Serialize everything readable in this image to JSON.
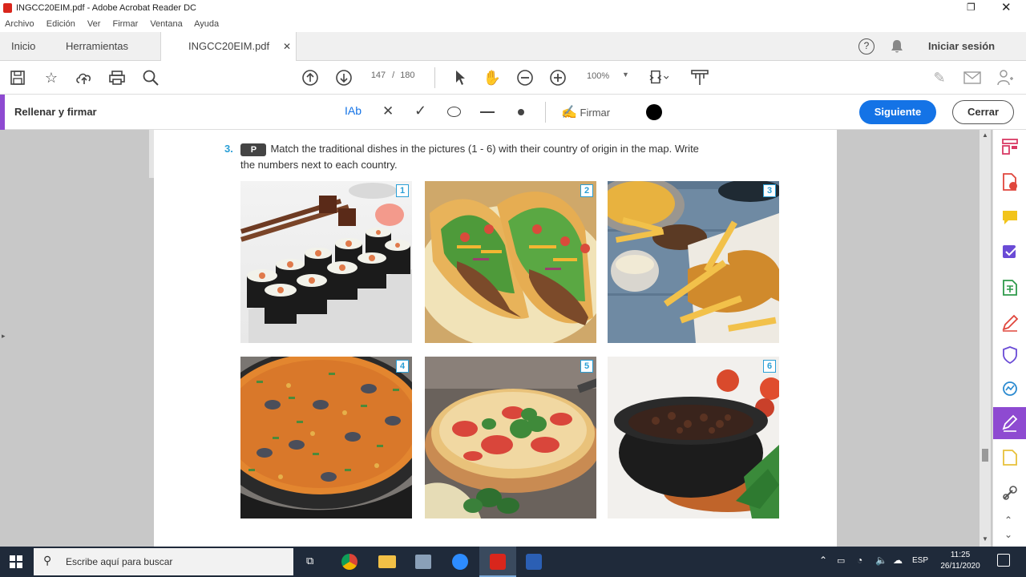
{
  "window": {
    "title": "INGCC20EIM.pdf - Adobe Acrobat Reader DC",
    "menu": [
      "Archivo",
      "Edición",
      "Ver",
      "Firmar",
      "Ventana",
      "Ayuda"
    ]
  },
  "tabs": {
    "home": "Inicio",
    "tools": "Herramientas",
    "document": "INGCC20EIM.pdf",
    "signin": "Iniciar sesión"
  },
  "toolbar": {
    "page_current": "147",
    "page_sep": "/",
    "page_total": "180",
    "zoom": "100%"
  },
  "fill_sign": {
    "label": "Rellenar y firmar",
    "text_tool": "Ab",
    "sign": "Firmar",
    "next": "Siguiente",
    "close": "Cerrar"
  },
  "document": {
    "exercise_number": "3.",
    "badge": "P",
    "instruction_line1": "Match the traditional dishes in the pictures (1 - 6) with their country of origin in the map. Write",
    "instruction_line2": "the numbers next to each country.",
    "pictures": [
      {
        "number": "1"
      },
      {
        "number": "2"
      },
      {
        "number": "3"
      },
      {
        "number": "4"
      },
      {
        "number": "5"
      },
      {
        "number": "6"
      }
    ]
  },
  "taskbar": {
    "search_placeholder": "Escribe aquí para buscar",
    "language": "ESP",
    "time": "11:25",
    "date": "26/11/2020"
  },
  "colors": {
    "accent_purple": "#8e4ad1",
    "adobe_blue": "#1473e6",
    "taskbar": "#1f2a3a"
  }
}
